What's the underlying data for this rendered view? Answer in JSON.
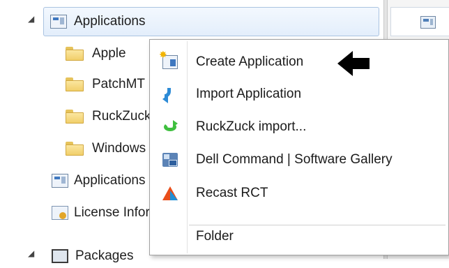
{
  "tree": {
    "items": [
      {
        "label": "Applications",
        "icon": "application-icon",
        "expander": "◢"
      },
      {
        "label": "Apple",
        "icon": "folder-icon"
      },
      {
        "label": "PatchMT",
        "icon": "folder-icon"
      },
      {
        "label": "RuckZuck",
        "icon": "folder-icon"
      },
      {
        "label": "Windows",
        "icon": "folder-icon"
      },
      {
        "label": "Applications",
        "icon": "application-icon"
      },
      {
        "label": "License Information",
        "icon": "license-icon"
      },
      {
        "label": "Packages",
        "icon": "package-icon",
        "expander": "◢"
      }
    ]
  },
  "context_menu": {
    "items": [
      {
        "label": "Create Application",
        "icon": "create-application-icon"
      },
      {
        "label": "Import Application",
        "icon": "import-application-icon"
      },
      {
        "label": "RuckZuck import...",
        "icon": "ruckzuck-icon"
      },
      {
        "label": "Dell Command | Software Gallery",
        "icon": "dell-command-icon"
      },
      {
        "label": "Recast RCT",
        "icon": "recast-icon"
      },
      {
        "label": "Folder",
        "icon": ""
      }
    ]
  },
  "annotation": {
    "icon": "black-arrow-pointing-left-icon",
    "color": "#000000"
  }
}
